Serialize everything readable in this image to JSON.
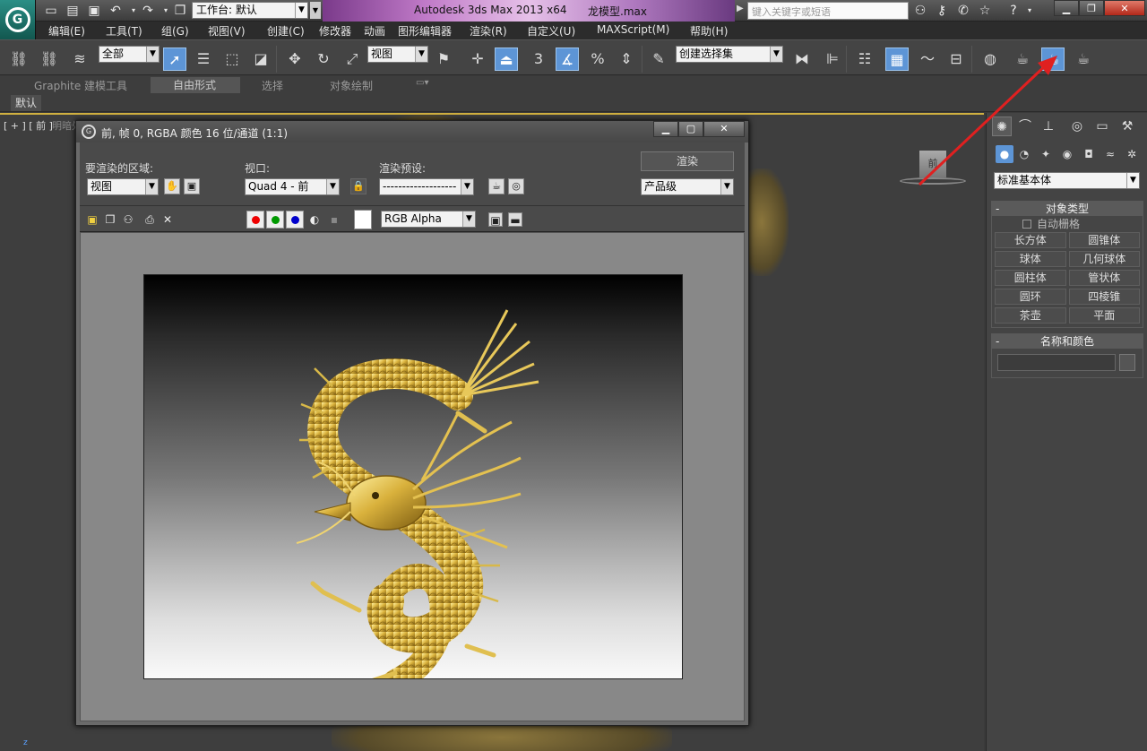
{
  "titlebar": {
    "workspace_label": "工作台: 默认",
    "app_title": "Autodesk 3ds Max  2013 x64",
    "file_title": "龙模型.max",
    "search_placeholder": "键入关键字或短语"
  },
  "menu": [
    "编辑(E)",
    "工具(T)",
    "组(G)",
    "视图(V)",
    "创建(C)",
    "修改器",
    "动画",
    "图形编辑器",
    "渲染(R)",
    "自定义(U)",
    "MAXScript(M)",
    "帮助(H)"
  ],
  "toolbar": {
    "selection_filter": "全部",
    "reference_coord": "视图",
    "spinner_snap_number": "3",
    "named_selection_set": "创建选择集"
  },
  "ribbon": {
    "tabs": [
      "Graphite 建模工具",
      "自由形式",
      "选择",
      "对象绘制"
    ],
    "sub_label": "默认"
  },
  "viewport": {
    "label": "[ + ] [ 前 ]",
    "label_dim": "明暗处理",
    "viewcube_label": "前",
    "axis_label": "z"
  },
  "command_panel": {
    "category": "标准基本体",
    "object_type_title": "对象类型",
    "autogrid_label": "自动栅格",
    "object_buttons": [
      "长方体",
      "圆锥体",
      "球体",
      "几何球体",
      "圆柱体",
      "管状体",
      "圆环",
      "四棱锥",
      "茶壶",
      "平面"
    ],
    "name_color_title": "名称和颜色"
  },
  "render_window": {
    "title": "前, 帧 0, RGBA 颜色 16 位/通道 (1:1)",
    "area_label": "要渲染的区域:",
    "area_value": "视图",
    "viewport_label": "视口:",
    "viewport_value": "Quad 4 - 前",
    "preset_label": "渲染预设:",
    "preset_value": "-------------------",
    "render_button": "渲染",
    "quality_value": "产品级",
    "channel_value": "RGB Alpha"
  },
  "colors": {
    "accent_blue": "#5d95d6",
    "viewport_border": "#d0b040",
    "arrow_red": "#e02020",
    "dragon_gold": "#d9b13c"
  }
}
